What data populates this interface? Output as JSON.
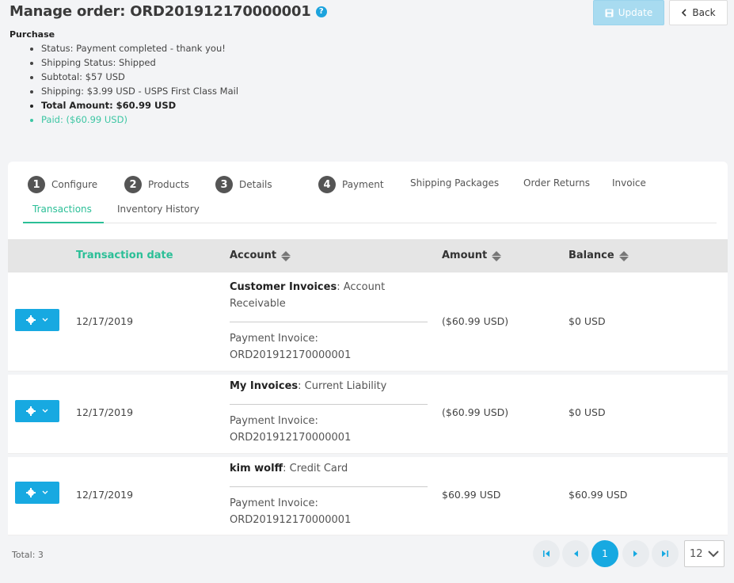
{
  "header": {
    "title": "Manage order: ORD201912170000001",
    "help_icon": "?",
    "update_label": "Update",
    "back_label": "Back"
  },
  "purchase": {
    "heading": "Purchase",
    "items": [
      "Status: Payment completed - thank you!",
      "Shipping Status: Shipped",
      "Subtotal: $57 USD",
      "Shipping: $3.99 USD - USPS First Class Mail",
      "Total Amount: $60.99 USD",
      "Paid: ($60.99 USD)"
    ]
  },
  "tabs": [
    {
      "num": "1",
      "label": "Configure"
    },
    {
      "num": "2",
      "label": "Products"
    },
    {
      "num": "3",
      "label": "Details"
    },
    {
      "num": "4",
      "label": "Payment"
    },
    {
      "label": "Shipping Packages"
    },
    {
      "label": "Order Returns"
    },
    {
      "label": "Invoice"
    },
    {
      "label": "Transactions"
    },
    {
      "label": "Inventory History"
    }
  ],
  "table": {
    "columns": [
      "Transaction date",
      "Account",
      "Amount",
      "Balance"
    ],
    "rows": [
      {
        "date": "12/17/2019",
        "account_name": "Customer Invoices",
        "account_type": ": Account Receivable",
        "ref_label": "Payment Invoice:",
        "ref_value": "ORD201912170000001",
        "amount": "($60.99 USD)",
        "balance": "$0 USD"
      },
      {
        "date": "12/17/2019",
        "account_name": "My Invoices",
        "account_type": ": Current Liability",
        "ref_label": "Payment Invoice:",
        "ref_value": "ORD201912170000001",
        "amount": "($60.99 USD)",
        "balance": "$0 USD"
      },
      {
        "date": "12/17/2019",
        "account_name": "kim wolff",
        "account_type": ": Credit Card",
        "ref_label": "Payment Invoice:",
        "ref_value": "ORD201912170000001",
        "amount": "$60.99 USD",
        "balance": "$60.99 USD"
      }
    ]
  },
  "footer": {
    "total": "Total: 3",
    "current_page": "1",
    "per_page": "12"
  },
  "colors": {
    "accent": "#2bbf97",
    "primary": "#17a9e1"
  }
}
